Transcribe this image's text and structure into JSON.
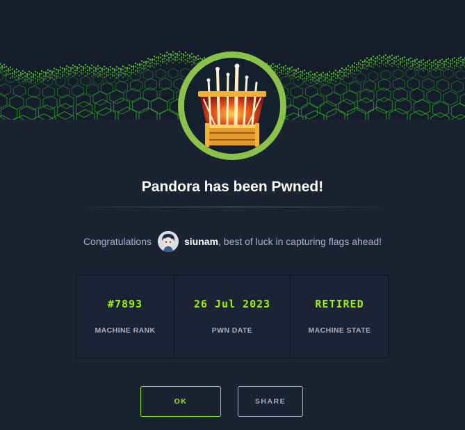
{
  "modal": {
    "title": "Pandora has been Pwned!",
    "congrats_prefix": "Congratulations",
    "username": "siunam",
    "congrats_suffix": ", best of luck in capturing flags ahead!"
  },
  "stats": [
    {
      "value": "#7893",
      "label": "MACHINE RANK"
    },
    {
      "value": "26 Jul 2023",
      "label": "PWN DATE"
    },
    {
      "value": "RETIRED",
      "label": "MACHINE STATE"
    }
  ],
  "buttons": {
    "ok": "OK",
    "share": "SHARE"
  },
  "colors": {
    "background": "#1a2332",
    "accent_green": "#9fef00",
    "badge_ring": "#8bc34a",
    "muted_text": "#a4b1cd"
  },
  "icons": {
    "banner": "green-grid-wave-banner",
    "badge": "pandora-box-badge-icon",
    "avatar": "user-avatar"
  }
}
